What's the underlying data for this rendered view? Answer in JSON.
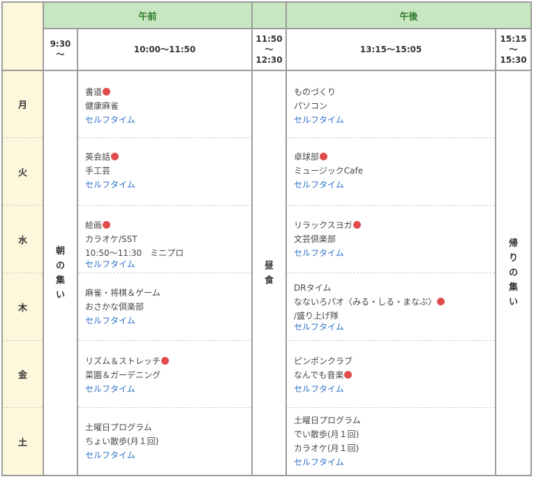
{
  "header": {
    "morning": "午前",
    "afternoon": "午後",
    "times": [
      "9:30\n〜",
      "10:00〜11:50",
      "11:50\n〜\n12:30",
      "13:15〜15:05",
      "15:15\n〜\n15:30"
    ]
  },
  "days": [
    "月",
    "火",
    "水",
    "木",
    "金",
    "土"
  ],
  "morning_gathering": [
    "朝",
    "の",
    "集",
    "い"
  ],
  "lunch": [
    "昼",
    "食"
  ],
  "leave_gathering": [
    "帰",
    "り",
    "の",
    "集",
    "い"
  ],
  "morning_programs": [
    [
      {
        "text": "書道",
        "dot": true
      },
      {
        "text": "健康麻雀"
      },
      {
        "text": "セルフタイム",
        "self": true
      }
    ],
    [
      {
        "text": "英会話",
        "dot": true
      },
      {
        "text": "手工芸"
      },
      {
        "text": "セルフタイム",
        "self": true
      }
    ],
    [
      {
        "text": "絵画",
        "dot": true
      },
      {
        "text": "カラオケ/SST"
      },
      {
        "text": "10:50〜11:30　ミニプロ"
      },
      {
        "text": "セルフタイム",
        "self": true
      }
    ],
    [
      {
        "text": "麻雀・将棋＆ゲーム"
      },
      {
        "text": "おさかな倶楽部"
      },
      {
        "text": "セルフタイム",
        "self": true
      }
    ],
    [
      {
        "text": "リズム＆ストレッチ",
        "dot": true
      },
      {
        "text": "菜園＆ガーデニング"
      },
      {
        "text": "セルフタイム",
        "self": true
      }
    ],
    [
      {
        "text": "土曜日プログラム"
      },
      {
        "text": "ちょい散歩(月１回)"
      },
      {
        "text": "セルフタイム",
        "self": true
      }
    ]
  ],
  "afternoon_programs": [
    [
      {
        "text": "ものづくり"
      },
      {
        "text": "パソコン"
      },
      {
        "text": "セルフタイム",
        "self": true
      }
    ],
    [
      {
        "text": "卓球部",
        "dot": true
      },
      {
        "text": "ミュージックCafe"
      },
      {
        "text": "セルフタイム",
        "self": true
      }
    ],
    [
      {
        "text": "リラックスヨガ",
        "dot": true
      },
      {
        "text": "文芸倶楽部"
      },
      {
        "text": "セルフタイム",
        "self": true
      }
    ],
    [
      {
        "text": "DRタイム"
      },
      {
        "text": "なないろパオ〈みる・しる・まなぶ〉",
        "dot": true
      },
      {
        "text": "/盛り上げ隊"
      },
      {
        "text": "セルフタイム",
        "self": true
      }
    ],
    [
      {
        "text": "ピンポンクラブ"
      },
      {
        "text": "なんでも音楽",
        "dot": true
      },
      {
        "text": "セルフタイム",
        "self": true
      }
    ],
    [
      {
        "text": "土曜日プログラム"
      },
      {
        "text": "でい散歩(月１回)"
      },
      {
        "text": "カラオケ(月１回)"
      },
      {
        "text": "セルフタイム",
        "self": true
      }
    ]
  ],
  "colors": {
    "header_green": "#c8e6c2",
    "header_text": "#2f7a2a",
    "day_cream": "#fdf7dc",
    "self_time_blue": "#2a70c8",
    "dot_red": "#e24b4b",
    "border": "#9a9a9a"
  }
}
